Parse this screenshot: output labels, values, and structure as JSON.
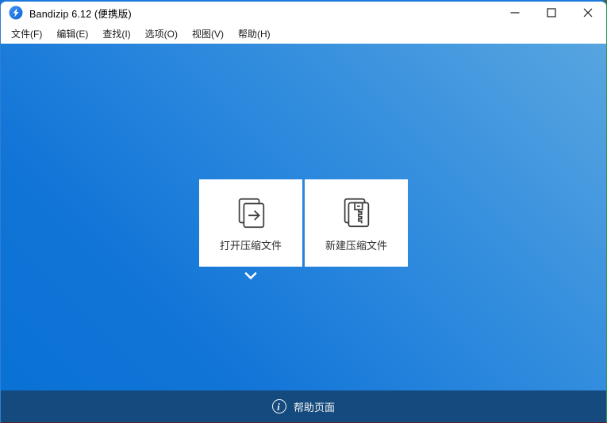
{
  "window": {
    "title": "Bandizip 6.12 (便携版)",
    "controls": {
      "minimize": "minimize",
      "maximize": "maximize",
      "close": "close"
    }
  },
  "menu": {
    "items": [
      {
        "label": "文件(F)"
      },
      {
        "label": "编辑(E)"
      },
      {
        "label": "查找(I)"
      },
      {
        "label": "选项(O)"
      },
      {
        "label": "视图(V)"
      },
      {
        "label": "帮助(H)"
      }
    ]
  },
  "main": {
    "buttons": [
      {
        "label": "打开压缩文件",
        "icon": "open-archive-icon"
      },
      {
        "label": "新建压缩文件",
        "icon": "new-archive-icon"
      }
    ],
    "expander_icon": "chevron-down-icon"
  },
  "statusbar": {
    "icon_glyph": "i",
    "help_label": "帮助页面"
  },
  "colors": {
    "gradient_top_right": "#57a5e0",
    "gradient_bottom_left": "#0a72d5",
    "statusbar_bg": "#144a7d",
    "titlebar_bg": "#ffffff",
    "logo_blue": "#1d74e0"
  }
}
